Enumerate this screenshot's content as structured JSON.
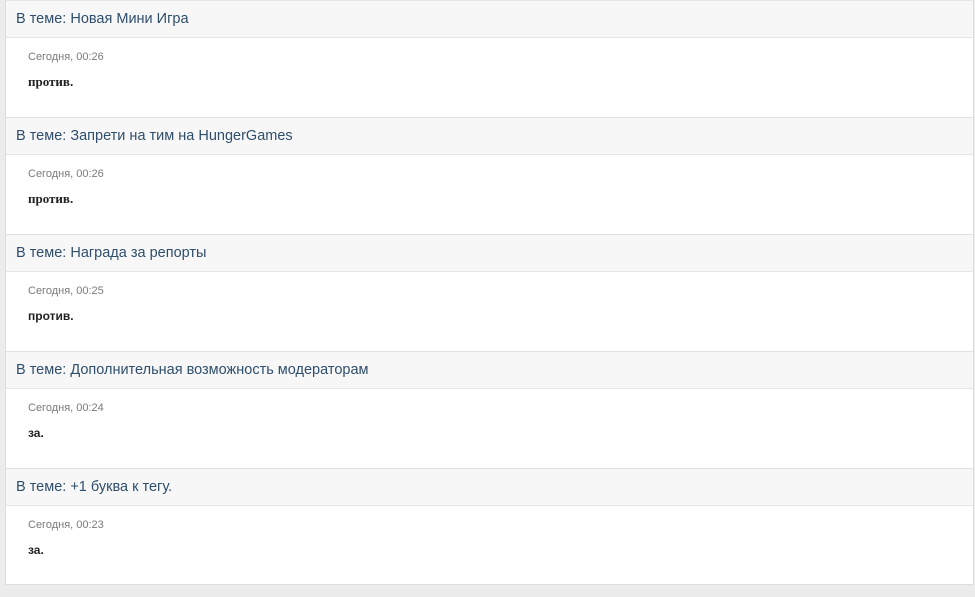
{
  "posts": [
    {
      "prefix": "В теме: ",
      "topic": "Новая Мини Игра",
      "date": "Сегодня, 00:26",
      "text": "против."
    },
    {
      "prefix": "В теме: ",
      "topic": "Запрети на тим на HungerGames",
      "date": "Сегодня, 00:26",
      "text": "против."
    },
    {
      "prefix": "В теме: ",
      "topic": "Награда за репорты",
      "date": "Сегодня, 00:25",
      "text": "против."
    },
    {
      "prefix": "В теме: ",
      "topic": "Дополнительная возможность модераторам",
      "date": "Сегодня, 00:24",
      "text": "за."
    },
    {
      "prefix": "В теме: ",
      "topic": "+1 буква к тегу.",
      "date": "Сегодня, 00:23",
      "text": "за."
    }
  ],
  "colors": {
    "topic_link": "#2f4e6b",
    "header_bg": "#f7f7f7",
    "date_text": "#7a7a7a"
  }
}
